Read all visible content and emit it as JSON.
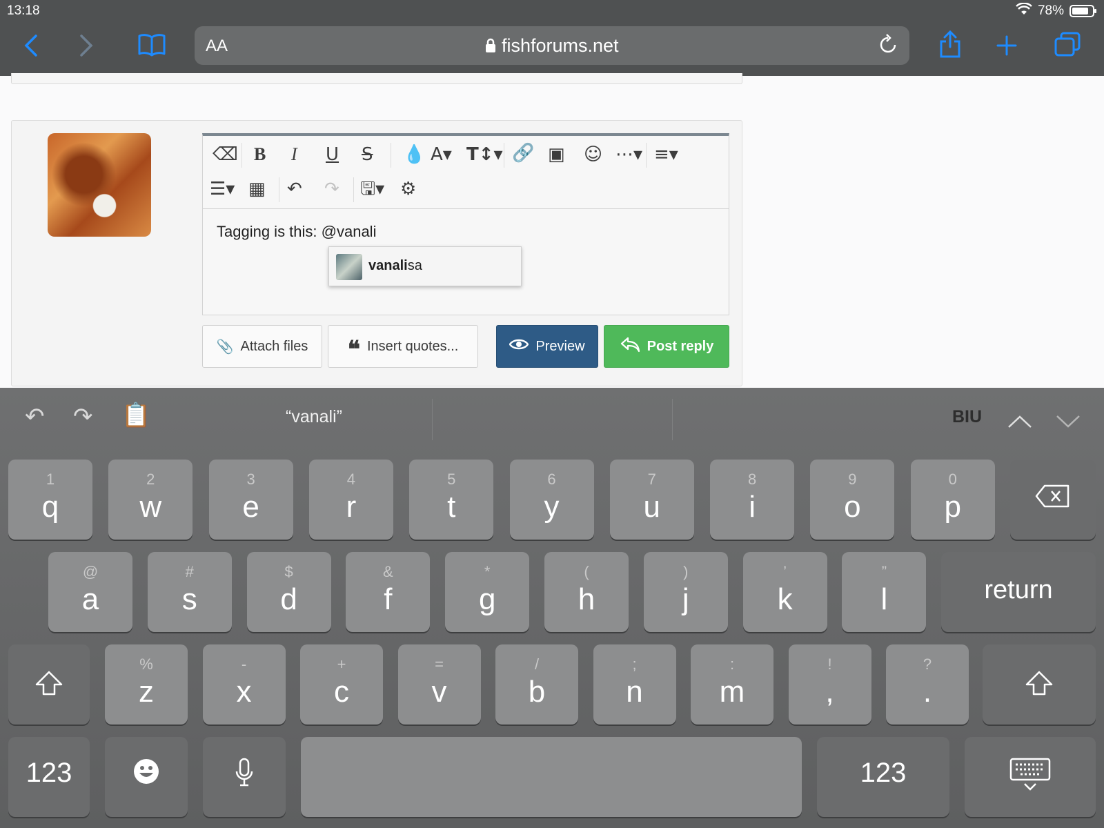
{
  "status": {
    "time": "13:18",
    "battery": "78%"
  },
  "browser": {
    "aa_label": "AA",
    "url": "fishforums.net"
  },
  "editor": {
    "text": "Tagging is this: @vanali",
    "mention": {
      "match": "vanali",
      "rest": "sa"
    }
  },
  "buttons": {
    "attach": "Attach files",
    "insert_quotes": "Insert quotes...",
    "preview": "Preview",
    "post_reply": "Post reply"
  },
  "keyboard": {
    "suggestion": "“vanali”",
    "format": "BIU",
    "row1": [
      {
        "k": "q",
        "a": "1"
      },
      {
        "k": "w",
        "a": "2"
      },
      {
        "k": "e",
        "a": "3"
      },
      {
        "k": "r",
        "a": "4"
      },
      {
        "k": "t",
        "a": "5"
      },
      {
        "k": "y",
        "a": "6"
      },
      {
        "k": "u",
        "a": "7"
      },
      {
        "k": "i",
        "a": "8"
      },
      {
        "k": "o",
        "a": "9"
      },
      {
        "k": "p",
        "a": "0"
      }
    ],
    "row2": [
      {
        "k": "a",
        "a": "@"
      },
      {
        "k": "s",
        "a": "#"
      },
      {
        "k": "d",
        "a": "$"
      },
      {
        "k": "f",
        "a": "&"
      },
      {
        "k": "g",
        "a": "*"
      },
      {
        "k": "h",
        "a": "("
      },
      {
        "k": "j",
        "a": ")"
      },
      {
        "k": "k",
        "a": "’"
      },
      {
        "k": "l",
        "a": "”"
      }
    ],
    "row3": [
      {
        "k": "z",
        "a": "%"
      },
      {
        "k": "x",
        "a": "-"
      },
      {
        "k": "c",
        "a": "+"
      },
      {
        "k": "v",
        "a": "="
      },
      {
        "k": "b",
        "a": "/"
      },
      {
        "k": "n",
        "a": ";"
      },
      {
        "k": "m",
        "a": ":"
      },
      {
        "k": ",",
        "a": "!"
      },
      {
        "k": ".",
        "a": "?"
      }
    ],
    "return_label": "return",
    "numbers_label": "123"
  }
}
